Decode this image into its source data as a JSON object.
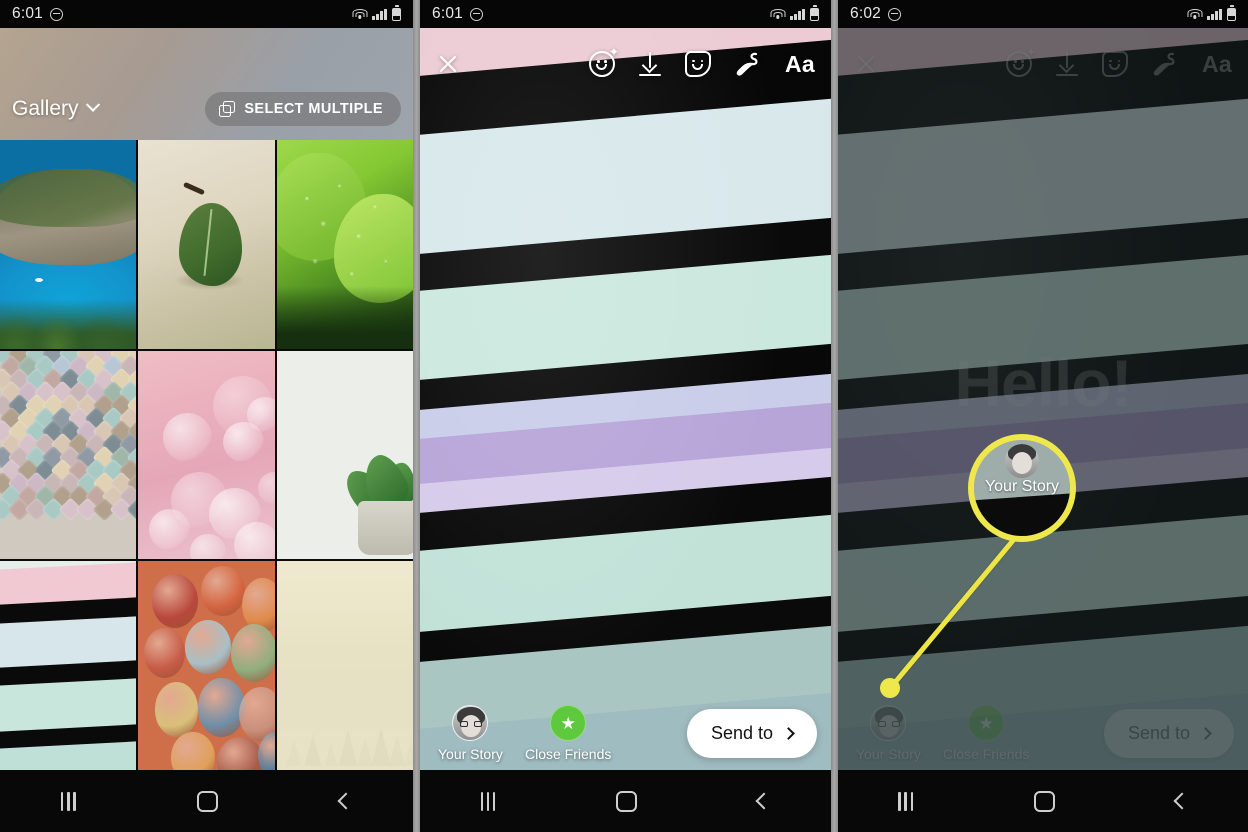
{
  "panels": [
    {
      "id": "gallery-picker",
      "status": {
        "time": "6:01",
        "dnd_icon": "do-not-disturb-icon",
        "wifi_icon": "wifi-icon",
        "signal_icon": "signal-icon",
        "battery_icon": "battery-icon"
      },
      "header": {
        "title": "Gallery",
        "chevron_icon": "chevron-down-icon",
        "select_multiple_label": "SELECT MULTIPLE",
        "select_multiple_icon": "copy-icon"
      },
      "thumbnails": [
        {
          "name": "beach-cove-photo",
          "style": "th-beach"
        },
        {
          "name": "green-leaf-sand-photo",
          "style": "th-leaf"
        },
        {
          "name": "wet-green-leaves-photo",
          "style": "th-wet"
        },
        {
          "name": "pastel-diamond-tiles-photo",
          "style": "th-tiles"
        },
        {
          "name": "pink-bokeh-photo",
          "style": "th-bokeh"
        },
        {
          "name": "succulent-plant-photo",
          "style": "th-plant"
        },
        {
          "name": "pastel-stripes-photo",
          "style": "th-stripe"
        },
        {
          "name": "colorful-pebbles-photo",
          "style": "th-pebble"
        },
        {
          "name": "misty-pine-forest-photo",
          "style": "th-forest"
        }
      ],
      "nav": {
        "recents": "recents-icon",
        "home": "home-icon",
        "back": "back-icon"
      }
    },
    {
      "id": "story-editor",
      "status": {
        "time": "6:01",
        "dnd_icon": "do-not-disturb-icon",
        "wifi_icon": "wifi-icon",
        "signal_icon": "signal-icon",
        "battery_icon": "battery-icon"
      },
      "toolbar": [
        {
          "name": "close-icon",
          "label": ""
        },
        {
          "name": "effects-face-icon",
          "label": ""
        },
        {
          "name": "download-icon",
          "label": ""
        },
        {
          "name": "sticker-icon",
          "label": ""
        },
        {
          "name": "draw-icon",
          "label": ""
        },
        {
          "name": "text-icon",
          "label": "Aa"
        }
      ],
      "bottom": {
        "your_story_label": "Your Story",
        "close_friends_label": "Close Friends",
        "send_to_label": "Send to",
        "send_to_chevron": "chevron-right-icon",
        "star_glyph": "★"
      },
      "nav": {
        "recents": "recents-icon",
        "home": "home-icon",
        "back": "back-icon"
      }
    },
    {
      "id": "story-editor-highlight",
      "status": {
        "time": "6:02",
        "dnd_icon": "do-not-disturb-icon",
        "wifi_icon": "wifi-icon",
        "signal_icon": "signal-icon",
        "battery_icon": "battery-icon"
      },
      "overlay_text": "Hello!",
      "toolbar": [
        {
          "name": "close-icon",
          "label": ""
        },
        {
          "name": "effects-face-icon",
          "label": ""
        },
        {
          "name": "download-icon",
          "label": ""
        },
        {
          "name": "sticker-icon",
          "label": ""
        },
        {
          "name": "draw-icon",
          "label": ""
        },
        {
          "name": "text-icon",
          "label": "Aa"
        }
      ],
      "callout": {
        "magnified_label": "Your Story",
        "highlight_color": "#efe84c"
      },
      "bottom": {
        "your_story_label": "Your Story",
        "close_friends_label": "Close Friends",
        "send_to_label": "Send to",
        "send_to_chevron": "chevron-right-icon",
        "star_glyph": "★"
      },
      "nav": {
        "recents": "recents-icon",
        "home": "home-icon",
        "back": "back-icon"
      }
    }
  ]
}
